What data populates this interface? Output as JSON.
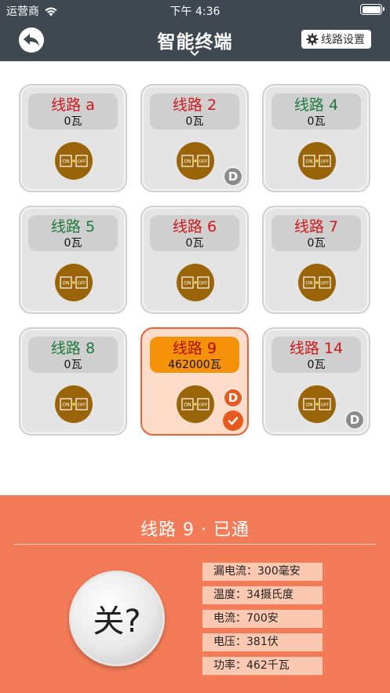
{
  "status_bar": {
    "carrier": "运营商",
    "time": "下午 4:36"
  },
  "nav": {
    "title": "智能终端",
    "settings_label": "线路设置"
  },
  "circuits": [
    {
      "name": "线路 a",
      "power": "0瓦",
      "color": "red"
    },
    {
      "name": "线路 2",
      "power": "0瓦",
      "color": "red",
      "badge": "D"
    },
    {
      "name": "线路 4",
      "power": "0瓦",
      "color": "green"
    },
    {
      "name": "线路 5",
      "power": "0瓦",
      "color": "green"
    },
    {
      "name": "线路 6",
      "power": "0瓦",
      "color": "red"
    },
    {
      "name": "线路 7",
      "power": "0瓦",
      "color": "red"
    },
    {
      "name": "线路 8",
      "power": "0瓦",
      "color": "green"
    },
    {
      "name": "线路 9",
      "power": "462000瓦",
      "color": "red",
      "badge": "D",
      "selected": true
    },
    {
      "name": "线路 14",
      "power": "0瓦",
      "color": "red",
      "badge": "D"
    }
  ],
  "switch_icon": {
    "on_label": "ON",
    "off_label": "OFF"
  },
  "detail": {
    "title": "线路 9 · 已通",
    "off_button_label": "关?",
    "metrics": [
      "漏电流：300毫安",
      "温度：34摄氏度",
      "电流：700安",
      "电压：381伏",
      "功率：462千瓦"
    ]
  },
  "colors": {
    "nav_bg": "#3f4750",
    "panel_bg": "#f47b57",
    "active_card_border": "#e6643a",
    "active_label_bg": "#f5920a",
    "switch_brown": "#9a6508"
  }
}
